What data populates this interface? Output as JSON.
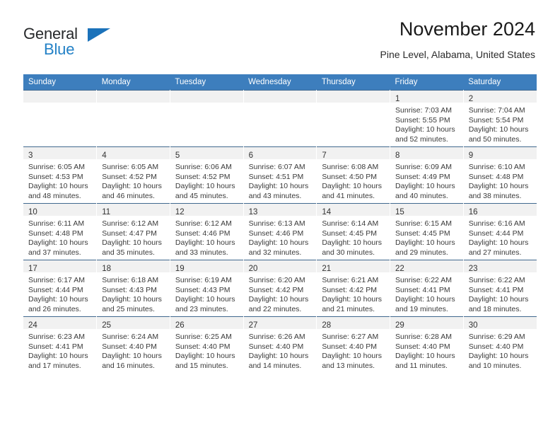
{
  "brand": {
    "name_part1": "General",
    "name_part2": "Blue",
    "triangle_icon": "triangle-icon",
    "color_dark": "#27292b",
    "color_blue": "#2381c6"
  },
  "header": {
    "title": "November 2024",
    "subtitle": "Pine Level, Alabama, United States"
  },
  "calendar": {
    "header_bg": "#3d7ebd",
    "daynum_bg": "#f1f1f1",
    "weekdays": [
      "Sunday",
      "Monday",
      "Tuesday",
      "Wednesday",
      "Thursday",
      "Friday",
      "Saturday"
    ],
    "weeks": [
      [
        {
          "day": "",
          "sunrise": "",
          "sunset": "",
          "daylight_line1": "",
          "daylight_line2": "",
          "empty": true
        },
        {
          "day": "",
          "sunrise": "",
          "sunset": "",
          "daylight_line1": "",
          "daylight_line2": "",
          "empty": true
        },
        {
          "day": "",
          "sunrise": "",
          "sunset": "",
          "daylight_line1": "",
          "daylight_line2": "",
          "empty": true
        },
        {
          "day": "",
          "sunrise": "",
          "sunset": "",
          "daylight_line1": "",
          "daylight_line2": "",
          "empty": true
        },
        {
          "day": "",
          "sunrise": "",
          "sunset": "",
          "daylight_line1": "",
          "daylight_line2": "",
          "empty": true
        },
        {
          "day": "1",
          "sunrise": "Sunrise: 7:03 AM",
          "sunset": "Sunset: 5:55 PM",
          "daylight_line1": "Daylight: 10 hours",
          "daylight_line2": "and 52 minutes.",
          "empty": false
        },
        {
          "day": "2",
          "sunrise": "Sunrise: 7:04 AM",
          "sunset": "Sunset: 5:54 PM",
          "daylight_line1": "Daylight: 10 hours",
          "daylight_line2": "and 50 minutes.",
          "empty": false
        }
      ],
      [
        {
          "day": "3",
          "sunrise": "Sunrise: 6:05 AM",
          "sunset": "Sunset: 4:53 PM",
          "daylight_line1": "Daylight: 10 hours",
          "daylight_line2": "and 48 minutes.",
          "empty": false
        },
        {
          "day": "4",
          "sunrise": "Sunrise: 6:05 AM",
          "sunset": "Sunset: 4:52 PM",
          "daylight_line1": "Daylight: 10 hours",
          "daylight_line2": "and 46 minutes.",
          "empty": false
        },
        {
          "day": "5",
          "sunrise": "Sunrise: 6:06 AM",
          "sunset": "Sunset: 4:52 PM",
          "daylight_line1": "Daylight: 10 hours",
          "daylight_line2": "and 45 minutes.",
          "empty": false
        },
        {
          "day": "6",
          "sunrise": "Sunrise: 6:07 AM",
          "sunset": "Sunset: 4:51 PM",
          "daylight_line1": "Daylight: 10 hours",
          "daylight_line2": "and 43 minutes.",
          "empty": false
        },
        {
          "day": "7",
          "sunrise": "Sunrise: 6:08 AM",
          "sunset": "Sunset: 4:50 PM",
          "daylight_line1": "Daylight: 10 hours",
          "daylight_line2": "and 41 minutes.",
          "empty": false
        },
        {
          "day": "8",
          "sunrise": "Sunrise: 6:09 AM",
          "sunset": "Sunset: 4:49 PM",
          "daylight_line1": "Daylight: 10 hours",
          "daylight_line2": "and 40 minutes.",
          "empty": false
        },
        {
          "day": "9",
          "sunrise": "Sunrise: 6:10 AM",
          "sunset": "Sunset: 4:48 PM",
          "daylight_line1": "Daylight: 10 hours",
          "daylight_line2": "and 38 minutes.",
          "empty": false
        }
      ],
      [
        {
          "day": "10",
          "sunrise": "Sunrise: 6:11 AM",
          "sunset": "Sunset: 4:48 PM",
          "daylight_line1": "Daylight: 10 hours",
          "daylight_line2": "and 37 minutes.",
          "empty": false
        },
        {
          "day": "11",
          "sunrise": "Sunrise: 6:12 AM",
          "sunset": "Sunset: 4:47 PM",
          "daylight_line1": "Daylight: 10 hours",
          "daylight_line2": "and 35 minutes.",
          "empty": false
        },
        {
          "day": "12",
          "sunrise": "Sunrise: 6:12 AM",
          "sunset": "Sunset: 4:46 PM",
          "daylight_line1": "Daylight: 10 hours",
          "daylight_line2": "and 33 minutes.",
          "empty": false
        },
        {
          "day": "13",
          "sunrise": "Sunrise: 6:13 AM",
          "sunset": "Sunset: 4:46 PM",
          "daylight_line1": "Daylight: 10 hours",
          "daylight_line2": "and 32 minutes.",
          "empty": false
        },
        {
          "day": "14",
          "sunrise": "Sunrise: 6:14 AM",
          "sunset": "Sunset: 4:45 PM",
          "daylight_line1": "Daylight: 10 hours",
          "daylight_line2": "and 30 minutes.",
          "empty": false
        },
        {
          "day": "15",
          "sunrise": "Sunrise: 6:15 AM",
          "sunset": "Sunset: 4:45 PM",
          "daylight_line1": "Daylight: 10 hours",
          "daylight_line2": "and 29 minutes.",
          "empty": false
        },
        {
          "day": "16",
          "sunrise": "Sunrise: 6:16 AM",
          "sunset": "Sunset: 4:44 PM",
          "daylight_line1": "Daylight: 10 hours",
          "daylight_line2": "and 27 minutes.",
          "empty": false
        }
      ],
      [
        {
          "day": "17",
          "sunrise": "Sunrise: 6:17 AM",
          "sunset": "Sunset: 4:44 PM",
          "daylight_line1": "Daylight: 10 hours",
          "daylight_line2": "and 26 minutes.",
          "empty": false
        },
        {
          "day": "18",
          "sunrise": "Sunrise: 6:18 AM",
          "sunset": "Sunset: 4:43 PM",
          "daylight_line1": "Daylight: 10 hours",
          "daylight_line2": "and 25 minutes.",
          "empty": false
        },
        {
          "day": "19",
          "sunrise": "Sunrise: 6:19 AM",
          "sunset": "Sunset: 4:43 PM",
          "daylight_line1": "Daylight: 10 hours",
          "daylight_line2": "and 23 minutes.",
          "empty": false
        },
        {
          "day": "20",
          "sunrise": "Sunrise: 6:20 AM",
          "sunset": "Sunset: 4:42 PM",
          "daylight_line1": "Daylight: 10 hours",
          "daylight_line2": "and 22 minutes.",
          "empty": false
        },
        {
          "day": "21",
          "sunrise": "Sunrise: 6:21 AM",
          "sunset": "Sunset: 4:42 PM",
          "daylight_line1": "Daylight: 10 hours",
          "daylight_line2": "and 21 minutes.",
          "empty": false
        },
        {
          "day": "22",
          "sunrise": "Sunrise: 6:22 AM",
          "sunset": "Sunset: 4:41 PM",
          "daylight_line1": "Daylight: 10 hours",
          "daylight_line2": "and 19 minutes.",
          "empty": false
        },
        {
          "day": "23",
          "sunrise": "Sunrise: 6:22 AM",
          "sunset": "Sunset: 4:41 PM",
          "daylight_line1": "Daylight: 10 hours",
          "daylight_line2": "and 18 minutes.",
          "empty": false
        }
      ],
      [
        {
          "day": "24",
          "sunrise": "Sunrise: 6:23 AM",
          "sunset": "Sunset: 4:41 PM",
          "daylight_line1": "Daylight: 10 hours",
          "daylight_line2": "and 17 minutes.",
          "empty": false
        },
        {
          "day": "25",
          "sunrise": "Sunrise: 6:24 AM",
          "sunset": "Sunset: 4:40 PM",
          "daylight_line1": "Daylight: 10 hours",
          "daylight_line2": "and 16 minutes.",
          "empty": false
        },
        {
          "day": "26",
          "sunrise": "Sunrise: 6:25 AM",
          "sunset": "Sunset: 4:40 PM",
          "daylight_line1": "Daylight: 10 hours",
          "daylight_line2": "and 15 minutes.",
          "empty": false
        },
        {
          "day": "27",
          "sunrise": "Sunrise: 6:26 AM",
          "sunset": "Sunset: 4:40 PM",
          "daylight_line1": "Daylight: 10 hours",
          "daylight_line2": "and 14 minutes.",
          "empty": false
        },
        {
          "day": "28",
          "sunrise": "Sunrise: 6:27 AM",
          "sunset": "Sunset: 4:40 PM",
          "daylight_line1": "Daylight: 10 hours",
          "daylight_line2": "and 13 minutes.",
          "empty": false
        },
        {
          "day": "29",
          "sunrise": "Sunrise: 6:28 AM",
          "sunset": "Sunset: 4:40 PM",
          "daylight_line1": "Daylight: 10 hours",
          "daylight_line2": "and 11 minutes.",
          "empty": false
        },
        {
          "day": "30",
          "sunrise": "Sunrise: 6:29 AM",
          "sunset": "Sunset: 4:40 PM",
          "daylight_line1": "Daylight: 10 hours",
          "daylight_line2": "and 10 minutes.",
          "empty": false
        }
      ]
    ]
  }
}
